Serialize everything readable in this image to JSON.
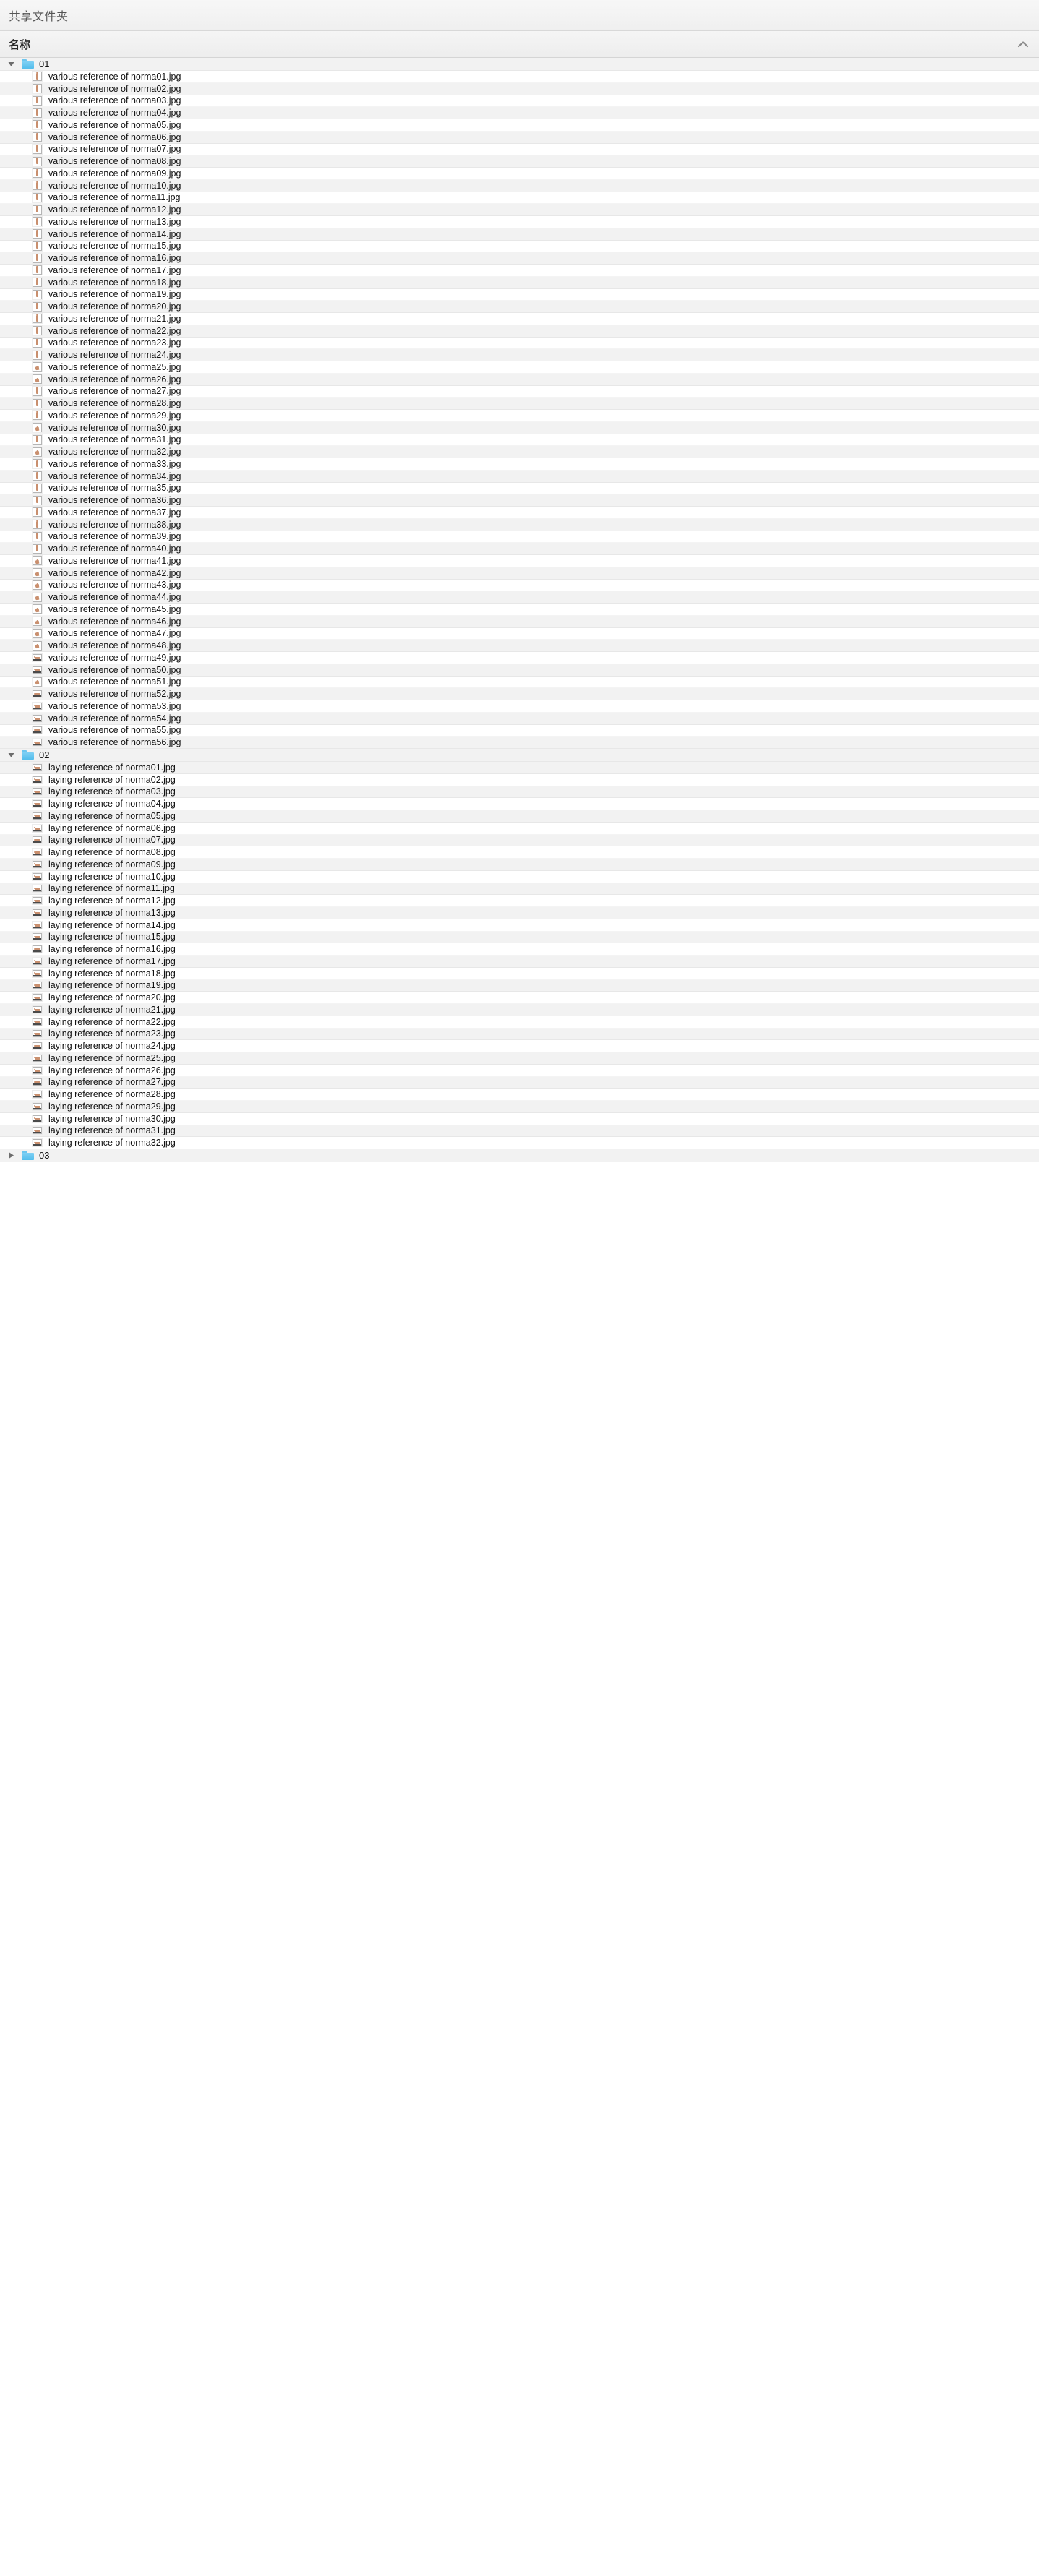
{
  "window": {
    "title": "共享文件夹"
  },
  "columns": {
    "name_header": "名称",
    "sort_icon": "chevron-up-icon",
    "sort_direction": "ascending"
  },
  "colors": {
    "folder_blue": "#54bdec",
    "row_alt": "#f2f2f2",
    "row_base": "#ffffff",
    "header_bg": "#ededed",
    "text": "#111111"
  },
  "tree": [
    {
      "type": "folder",
      "name": "01",
      "expanded": true,
      "twisty_icon": "triangle-down-icon",
      "folder_icon": "folder-icon",
      "files": [
        {
          "name": "various reference of norma01.jpg",
          "thumb": "thumb-standing"
        },
        {
          "name": "various reference of norma02.jpg",
          "thumb": "thumb-standing"
        },
        {
          "name": "various reference of norma03.jpg",
          "thumb": "thumb-standing"
        },
        {
          "name": "various reference of norma04.jpg",
          "thumb": "thumb-standing"
        },
        {
          "name": "various reference of norma05.jpg",
          "thumb": "thumb-standing"
        },
        {
          "name": "various reference of norma06.jpg",
          "thumb": "thumb-standing"
        },
        {
          "name": "various reference of norma07.jpg",
          "thumb": "thumb-standing"
        },
        {
          "name": "various reference of norma08.jpg",
          "thumb": "thumb-standing"
        },
        {
          "name": "various reference of norma09.jpg",
          "thumb": "thumb-standing"
        },
        {
          "name": "various reference of norma10.jpg",
          "thumb": "thumb-standing"
        },
        {
          "name": "various reference of norma11.jpg",
          "thumb": "thumb-standing"
        },
        {
          "name": "various reference of norma12.jpg",
          "thumb": "thumb-standing"
        },
        {
          "name": "various reference of norma13.jpg",
          "thumb": "thumb-standing"
        },
        {
          "name": "various reference of norma14.jpg",
          "thumb": "thumb-standing"
        },
        {
          "name": "various reference of norma15.jpg",
          "thumb": "thumb-standing"
        },
        {
          "name": "various reference of norma16.jpg",
          "thumb": "thumb-standing"
        },
        {
          "name": "various reference of norma17.jpg",
          "thumb": "thumb-standing"
        },
        {
          "name": "various reference of norma18.jpg",
          "thumb": "thumb-standing"
        },
        {
          "name": "various reference of norma19.jpg",
          "thumb": "thumb-standing"
        },
        {
          "name": "various reference of norma20.jpg",
          "thumb": "thumb-standing"
        },
        {
          "name": "various reference of norma21.jpg",
          "thumb": "thumb-standing"
        },
        {
          "name": "various reference of norma22.jpg",
          "thumb": "thumb-standing"
        },
        {
          "name": "various reference of norma23.jpg",
          "thumb": "thumb-standing"
        },
        {
          "name": "various reference of norma24.jpg",
          "thumb": "thumb-standing"
        },
        {
          "name": "various reference of norma25.jpg",
          "thumb": "thumb-sitting"
        },
        {
          "name": "various reference of norma26.jpg",
          "thumb": "thumb-sitting"
        },
        {
          "name": "various reference of norma27.jpg",
          "thumb": "thumb-standing"
        },
        {
          "name": "various reference of norma28.jpg",
          "thumb": "thumb-standing"
        },
        {
          "name": "various reference of norma29.jpg",
          "thumb": "thumb-standing"
        },
        {
          "name": "various reference of norma30.jpg",
          "thumb": "thumb-sitting"
        },
        {
          "name": "various reference of norma31.jpg",
          "thumb": "thumb-standing"
        },
        {
          "name": "various reference of norma32.jpg",
          "thumb": "thumb-sitting"
        },
        {
          "name": "various reference of norma33.jpg",
          "thumb": "thumb-standing"
        },
        {
          "name": "various reference of norma34.jpg",
          "thumb": "thumb-standing"
        },
        {
          "name": "various reference of norma35.jpg",
          "thumb": "thumb-standing"
        },
        {
          "name": "various reference of norma36.jpg",
          "thumb": "thumb-standing"
        },
        {
          "name": "various reference of norma37.jpg",
          "thumb": "thumb-standing"
        },
        {
          "name": "various reference of norma38.jpg",
          "thumb": "thumb-standing"
        },
        {
          "name": "various reference of norma39.jpg",
          "thumb": "thumb-standing"
        },
        {
          "name": "various reference of norma40.jpg",
          "thumb": "thumb-standing"
        },
        {
          "name": "various reference of norma41.jpg",
          "thumb": "thumb-sitting"
        },
        {
          "name": "various reference of norma42.jpg",
          "thumb": "thumb-sitting"
        },
        {
          "name": "various reference of norma43.jpg",
          "thumb": "thumb-sitting"
        },
        {
          "name": "various reference of norma44.jpg",
          "thumb": "thumb-sitting"
        },
        {
          "name": "various reference of norma45.jpg",
          "thumb": "thumb-sitting"
        },
        {
          "name": "various reference of norma46.jpg",
          "thumb": "thumb-sitting"
        },
        {
          "name": "various reference of norma47.jpg",
          "thumb": "thumb-sitting"
        },
        {
          "name": "various reference of norma48.jpg",
          "thumb": "thumb-sitting"
        },
        {
          "name": "various reference of norma49.jpg",
          "thumb": "thumb-laying"
        },
        {
          "name": "various reference of norma50.jpg",
          "thumb": "thumb-laying"
        },
        {
          "name": "various reference of norma51.jpg",
          "thumb": "thumb-sitting"
        },
        {
          "name": "various reference of norma52.jpg",
          "thumb": "thumb-laying"
        },
        {
          "name": "various reference of norma53.jpg",
          "thumb": "thumb-laying"
        },
        {
          "name": "various reference of norma54.jpg",
          "thumb": "thumb-laying"
        },
        {
          "name": "various reference of norma55.jpg",
          "thumb": "thumb-laying"
        },
        {
          "name": "various reference of norma56.jpg",
          "thumb": "thumb-laying"
        }
      ]
    },
    {
      "type": "folder",
      "name": "02",
      "expanded": true,
      "twisty_icon": "triangle-down-icon",
      "folder_icon": "folder-icon",
      "files": [
        {
          "name": "laying reference of norma01.jpg",
          "thumb": "thumb-laying"
        },
        {
          "name": "laying reference of norma02.jpg",
          "thumb": "thumb-laying"
        },
        {
          "name": "laying reference of norma03.jpg",
          "thumb": "thumb-laying"
        },
        {
          "name": "laying reference of norma04.jpg",
          "thumb": "thumb-laying"
        },
        {
          "name": "laying reference of norma05.jpg",
          "thumb": "thumb-laying"
        },
        {
          "name": "laying reference of norma06.jpg",
          "thumb": "thumb-laying"
        },
        {
          "name": "laying reference of norma07.jpg",
          "thumb": "thumb-laying"
        },
        {
          "name": "laying reference of norma08.jpg",
          "thumb": "thumb-laying"
        },
        {
          "name": "laying reference of norma09.jpg",
          "thumb": "thumb-laying"
        },
        {
          "name": "laying reference of norma10.jpg",
          "thumb": "thumb-laying"
        },
        {
          "name": "laying reference of norma11.jpg",
          "thumb": "thumb-laying"
        },
        {
          "name": "laying reference of norma12.jpg",
          "thumb": "thumb-laying"
        },
        {
          "name": "laying reference of norma13.jpg",
          "thumb": "thumb-laying"
        },
        {
          "name": "laying reference of norma14.jpg",
          "thumb": "thumb-laying"
        },
        {
          "name": "laying reference of norma15.jpg",
          "thumb": "thumb-laying"
        },
        {
          "name": "laying reference of norma16.jpg",
          "thumb": "thumb-laying"
        },
        {
          "name": "laying reference of norma17.jpg",
          "thumb": "thumb-laying"
        },
        {
          "name": "laying reference of norma18.jpg",
          "thumb": "thumb-laying"
        },
        {
          "name": "laying reference of norma19.jpg",
          "thumb": "thumb-laying"
        },
        {
          "name": "laying reference of norma20.jpg",
          "thumb": "thumb-laying"
        },
        {
          "name": "laying reference of norma21.jpg",
          "thumb": "thumb-laying"
        },
        {
          "name": "laying reference of norma22.jpg",
          "thumb": "thumb-laying"
        },
        {
          "name": "laying reference of norma23.jpg",
          "thumb": "thumb-laying"
        },
        {
          "name": "laying reference of norma24.jpg",
          "thumb": "thumb-laying"
        },
        {
          "name": "laying reference of norma25.jpg",
          "thumb": "thumb-laying"
        },
        {
          "name": "laying reference of norma26.jpg",
          "thumb": "thumb-laying"
        },
        {
          "name": "laying reference of norma27.jpg",
          "thumb": "thumb-laying"
        },
        {
          "name": "laying reference of norma28.jpg",
          "thumb": "thumb-laying"
        },
        {
          "name": "laying reference of norma29.jpg",
          "thumb": "thumb-laying"
        },
        {
          "name": "laying reference of norma30.jpg",
          "thumb": "thumb-laying"
        },
        {
          "name": "laying reference of norma31.jpg",
          "thumb": "thumb-laying"
        },
        {
          "name": "laying reference of norma32.jpg",
          "thumb": "thumb-laying"
        }
      ]
    },
    {
      "type": "folder",
      "name": "03",
      "expanded": false,
      "twisty_icon": "triangle-right-icon",
      "folder_icon": "folder-icon",
      "files": []
    }
  ]
}
